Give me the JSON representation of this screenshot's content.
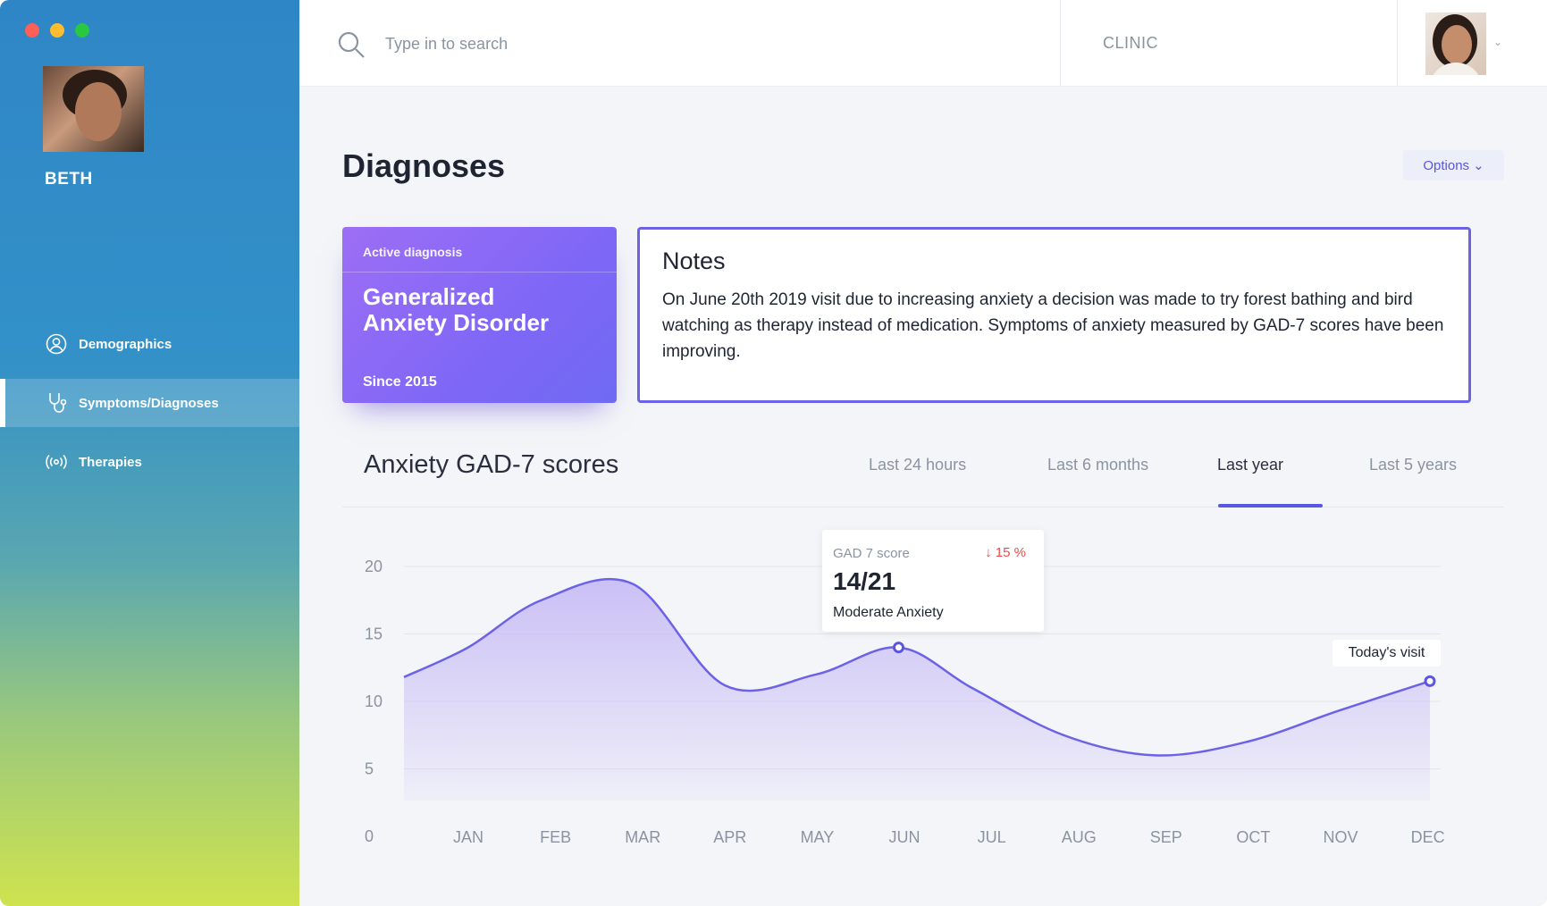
{
  "patient": {
    "name": "BETH"
  },
  "sidebar": {
    "items": [
      {
        "label": "Demographics",
        "icon": "person-circle-icon",
        "active": false
      },
      {
        "label": "Symptoms/Diagnoses",
        "icon": "stethoscope-icon",
        "active": true
      },
      {
        "label": "Therapies",
        "icon": "broadcast-icon",
        "active": false
      }
    ]
  },
  "topbar": {
    "search_placeholder": "Type in to search",
    "clinic_label": "CLINIC"
  },
  "main": {
    "title": "Diagnoses",
    "options_label": "Options",
    "diagnosis": {
      "tag": "Active diagnosis",
      "name": "Generalized Anxiety Disorder",
      "since": "Since 2015"
    },
    "notes": {
      "title": "Notes",
      "body": "On June 20th 2019 visit due to increasing anxiety a decision was made to try forest bathing and bird watching as therapy instead of medication. Symptoms of anxiety measured by GAD-7 scores have been improving."
    }
  },
  "chart_section": {
    "title": "Anxiety GAD-7 scores",
    "tabs": [
      "Last 24 hours",
      "Last 6 months",
      "Last year",
      "Last 5 years"
    ],
    "active_tab": 2,
    "tooltip": {
      "label": "GAD 7 score",
      "delta": "↓ 15 %",
      "value": "14/21",
      "description": "Moderate Anxiety"
    },
    "today_label": "Today's visit"
  },
  "colors": {
    "accent": "#5b56e0",
    "line": "#6c62e8",
    "fill": "#c8bdf6",
    "negative": "#ef4a4a"
  },
  "chart_data": {
    "type": "area",
    "categories": [
      "JAN",
      "FEB",
      "MAR",
      "APR",
      "MAY",
      "JUN",
      "JUL",
      "AUG",
      "SEP",
      "OCT",
      "NOV",
      "DEC"
    ],
    "series": [
      {
        "x": [
          0,
          0.7,
          1.5,
          2.5,
          3.5,
          4.5,
          5.4,
          6.2,
          7.2,
          8.2,
          9.2,
          10.2,
          11.2
        ],
        "values": [
          11.8,
          14.0,
          17.5,
          18.7,
          11.2,
          12.0,
          14.0,
          11.0,
          7.5,
          6.0,
          7.0,
          9.3,
          11.5
        ]
      }
    ],
    "ylim": [
      0,
      20
    ],
    "yticks": [
      0,
      5,
      10,
      15,
      20
    ],
    "grid": true,
    "highlighted_point": {
      "x": 5.4,
      "y": 14.0
    },
    "today_point": {
      "x": 11.2,
      "y": 11.5
    }
  }
}
